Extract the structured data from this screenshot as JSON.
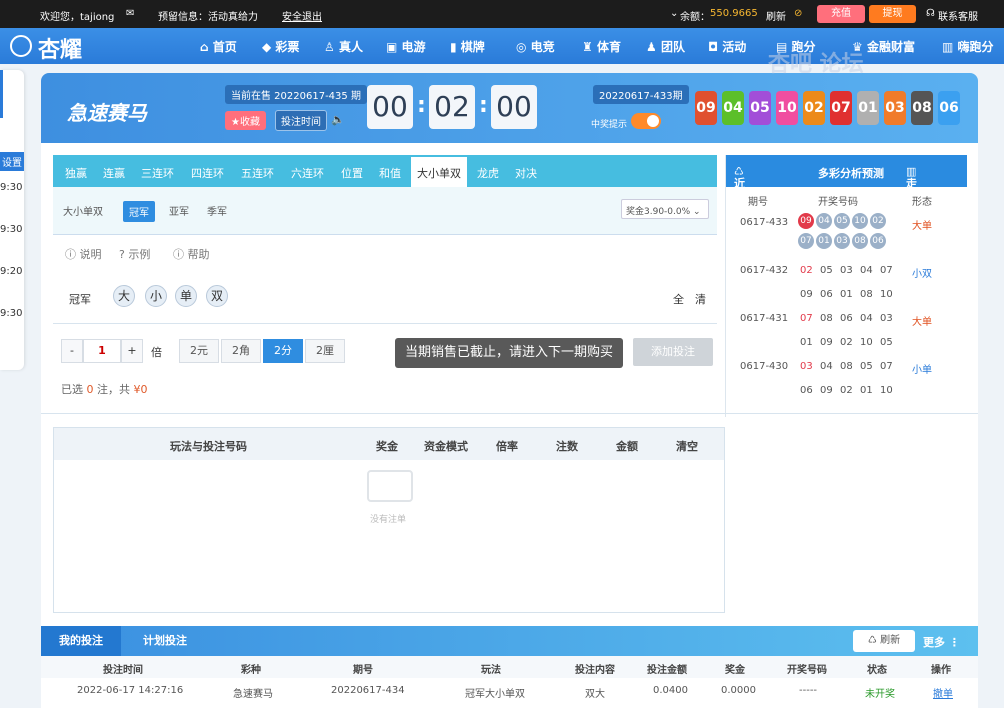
{
  "topbar": {
    "welcome": "欢迎您，tajiong",
    "notice": "预留信息：活动真给力",
    "logout": "安全退出",
    "balance_label": "余额：",
    "balance": "550.9665",
    "refresh": "刷新",
    "deposit": "充值",
    "withdraw": "提现",
    "support": "联系客服"
  },
  "nav": {
    "brand": "杏耀",
    "items": [
      "首页",
      "彩票",
      "真人",
      "电游",
      "棋牌",
      "电竞",
      "体育",
      "团队",
      "活动",
      "跑分",
      "金融财富",
      "嗨跑分"
    ]
  },
  "sidebar": {
    "label": "设置",
    "times": [
      "9:30",
      "9:30",
      "9:20",
      "9:30"
    ]
  },
  "hero": {
    "game": "急速赛马",
    "current_label": "当前在售 20220617-435 期",
    "collect": "收藏",
    "bet_time": "投注时间",
    "countdown": [
      "00",
      "02",
      "00"
    ],
    "last_issue": "20220617-433期",
    "toggle_label": "中奖提示",
    "balls": [
      "09",
      "04",
      "05",
      "10",
      "02",
      "07",
      "01",
      "03",
      "08",
      "06"
    ],
    "ball_colors": [
      "#e0502f",
      "#5cbf2a",
      "#a24ed8",
      "#f04ea0",
      "#ec8a1a",
      "#e03030",
      "#b0b0b0",
      "#f07b2a",
      "#555",
      "#3ba0f0"
    ]
  },
  "tabs": [
    "独赢",
    "连赢",
    "三连环",
    "四连环",
    "五连环",
    "六连环",
    "位置",
    "和值",
    "大小单双",
    "龙虎",
    "对决"
  ],
  "subtabs": {
    "label": "大小单双",
    "items": [
      "冠军",
      "亚军",
      "季军"
    ],
    "odds": "奖金3.90-0.0%"
  },
  "help": [
    "说明",
    "示例",
    "帮助"
  ],
  "picker": {
    "label": "冠军",
    "balls": [
      "大",
      "小",
      "单",
      "双"
    ],
    "all": "全",
    "clear": "清"
  },
  "bet": {
    "minus": "-",
    "qty": "1",
    "plus": "+",
    "times": "倍",
    "units": [
      "2元",
      "2角",
      "2分",
      "2厘"
    ],
    "toast": "当期销售已截止，请进入下一期购买",
    "add": "添加投注",
    "summary_prefix": "已选",
    "count": "0",
    "summary_mid": "注，共",
    "amount": "¥0"
  },
  "right": {
    "tabs": [
      "近期开奖",
      "多彩分析预测",
      "走势图"
    ],
    "cols": [
      "期号",
      "开奖号码",
      "形态"
    ],
    "rows": [
      {
        "issue": "0617-433",
        "nums1": [
          "09",
          "04",
          "05",
          "10",
          "02"
        ],
        "nums2": [
          "07",
          "01",
          "03",
          "08",
          "06"
        ],
        "form": "大单"
      },
      {
        "issue": "0617-432",
        "nums1": [
          "02",
          "05",
          "03",
          "04",
          "07"
        ],
        "nums2": [
          "09",
          "06",
          "01",
          "08",
          "10"
        ],
        "form": "小双"
      },
      {
        "issue": "0617-431",
        "nums1": [
          "07",
          "08",
          "06",
          "04",
          "03"
        ],
        "nums2": [
          "01",
          "09",
          "02",
          "10",
          "05"
        ],
        "form": "大单"
      },
      {
        "issue": "0617-430",
        "nums1": [
          "03",
          "04",
          "08",
          "05",
          "07"
        ],
        "nums2": [
          "06",
          "09",
          "02",
          "01",
          "10"
        ],
        "form": "小单"
      }
    ]
  },
  "bets_table": {
    "cols": [
      "玩法与投注号码",
      "奖金",
      "资金模式",
      "倍率",
      "注数",
      "金额",
      "清空"
    ],
    "empty": "没有注单"
  },
  "history": {
    "tabs": [
      "我的投注",
      "计划投注"
    ],
    "refresh": "刷新",
    "more": "更多",
    "cols": [
      "投注时间",
      "彩种",
      "期号",
      "玩法",
      "投注内容",
      "投注金额",
      "奖金",
      "开奖号码",
      "状态",
      "操作"
    ],
    "row": [
      "2022-06-17 14:27:16",
      "急速赛马",
      "20220617-434",
      "冠军大小单双",
      "双大",
      "0.0400",
      "0.0000",
      "-----",
      "未开奖",
      "撤单"
    ]
  },
  "watermark": "杏吧 论坛"
}
